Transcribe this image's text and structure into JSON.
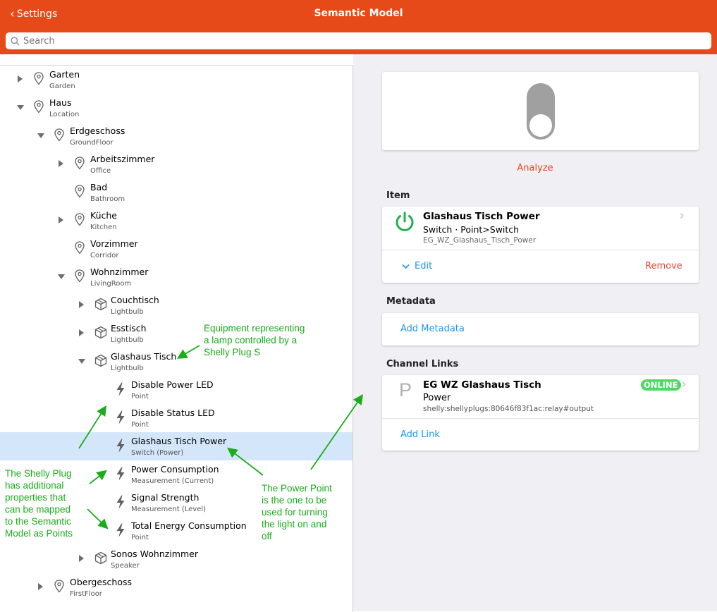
{
  "header": {
    "back_label": "Settings",
    "title": "Semantic Model",
    "search_placeholder": "Search",
    "background_color": "#e64a19"
  },
  "tree": [
    {
      "label": "Garten",
      "sub": "Garden",
      "icon": "location-pin-icon",
      "expander": "collapsed",
      "depth": 0
    },
    {
      "label": "Haus",
      "sub": "Location",
      "icon": "location-pin-icon",
      "expander": "expanded",
      "depth": 0
    },
    {
      "label": "Erdgeschoss",
      "sub": "GroundFloor",
      "icon": "location-pin-icon",
      "expander": "expanded",
      "depth": 1
    },
    {
      "label": "Arbeitszimmer",
      "sub": "Office",
      "icon": "location-pin-icon",
      "expander": "collapsed",
      "depth": 2
    },
    {
      "label": "Bad",
      "sub": "Bathroom",
      "icon": "location-pin-icon",
      "expander": "none",
      "depth": 2
    },
    {
      "label": "Küche",
      "sub": "Kitchen",
      "icon": "location-pin-icon",
      "expander": "collapsed",
      "depth": 2
    },
    {
      "label": "Vorzimmer",
      "sub": "Corridor",
      "icon": "location-pin-icon",
      "expander": "none",
      "depth": 2
    },
    {
      "label": "Wohnzimmer",
      "sub": "LivingRoom",
      "icon": "location-pin-icon",
      "expander": "expanded",
      "depth": 2
    },
    {
      "label": "Couchtisch",
      "sub": "Lightbulb",
      "icon": "cube-icon",
      "expander": "collapsed",
      "depth": 3
    },
    {
      "label": "Esstisch",
      "sub": "Lightbulb",
      "icon": "cube-icon",
      "expander": "collapsed",
      "depth": 3
    },
    {
      "label": "Glashaus Tisch",
      "sub": "Lightbulb",
      "icon": "cube-icon",
      "expander": "expanded",
      "depth": 3
    },
    {
      "label": "Disable Power LED",
      "sub": "Point",
      "icon": "bolt-icon",
      "expander": "none",
      "depth": 4
    },
    {
      "label": "Disable Status LED",
      "sub": "Point",
      "icon": "bolt-icon",
      "expander": "none",
      "depth": 4
    },
    {
      "label": "Glashaus Tisch Power",
      "sub": "Switch (Power)",
      "icon": "bolt-icon",
      "expander": "none",
      "depth": 4,
      "selected": true
    },
    {
      "label": "Power Consumption",
      "sub": "Measurement (Current)",
      "icon": "bolt-icon",
      "expander": "none",
      "depth": 4
    },
    {
      "label": "Signal Strength",
      "sub": "Measurement (Level)",
      "icon": "bolt-icon",
      "expander": "none",
      "depth": 4
    },
    {
      "label": "Total Energy Consumption",
      "sub": "Point",
      "icon": "bolt-icon",
      "expander": "none",
      "depth": 4
    },
    {
      "label": "Sonos Wohnzimmer",
      "sub": "Speaker",
      "icon": "cube-icon",
      "expander": "collapsed",
      "depth": 3
    },
    {
      "label": "Obergeschoss",
      "sub": "FirstFloor",
      "icon": "location-pin-icon",
      "expander": "collapsed",
      "depth": 1
    }
  ],
  "detail": {
    "state": "off",
    "analyze_label": "Analyze",
    "item_section_title": "Item",
    "item": {
      "name": "Glashaus Tisch Power",
      "type": "Switch · Point>Switch",
      "id": "EG_WZ_Glashaus_Tisch_Power",
      "icon": "power-icon",
      "edit_label": "Edit",
      "remove_label": "Remove"
    },
    "metadata_section_title": "Metadata",
    "add_metadata_label": "Add Metadata",
    "channel_section_title": "Channel Links",
    "channel": {
      "letter": "P",
      "thing": "EG WZ Glashaus Tisch",
      "channel_name": "Power",
      "uid": "shelly:shellyplugs:80646f83f1ac:relay#output",
      "status": "ONLINE"
    },
    "add_link_label": "Add Link"
  },
  "annotations": {
    "equipment": [
      "Equipment representing",
      "a lamp controlled by a",
      "Shelly Plug S"
    ],
    "shelly": [
      "The Shelly Plug",
      "has additional",
      "properties that",
      "can be mapped",
      "to the Semantic",
      "Model as Points"
    ],
    "power_point": [
      "The Power Point",
      "is the one to be",
      "used for turning",
      "the light on and",
      "off"
    ]
  },
  "colors": {
    "accent": "#e64a19",
    "link": "#2196f3",
    "remove": "#f44336",
    "online": "#4cd964",
    "power_icon": "#21b24b",
    "selected_row": "#d3e6fa",
    "annotation": "#1aac1a",
    "toggle_off": "#a0a0a0"
  }
}
